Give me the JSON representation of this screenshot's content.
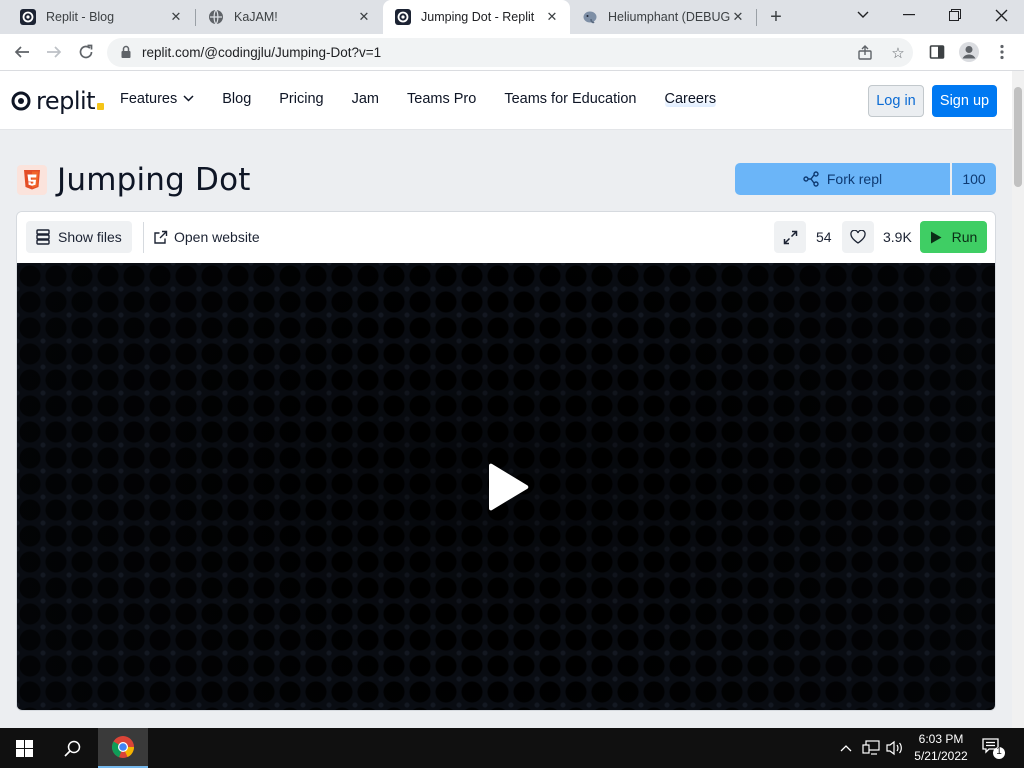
{
  "browser": {
    "tabs": [
      {
        "title": "Replit - Blog",
        "favicon": "replit-favicon-icon",
        "active": false
      },
      {
        "title": "KaJAM!",
        "favicon": "globe-icon",
        "active": false
      },
      {
        "title": "Jumping Dot - Replit",
        "favicon": "replit-favicon-icon",
        "active": true
      },
      {
        "title": "Heliumphant (DEBUG)",
        "favicon": "elephant-icon",
        "active": false
      }
    ],
    "url": "replit.com/@codingjlu/Jumping-Dot?v=1"
  },
  "header": {
    "logo_text": "replit",
    "nav": [
      {
        "label": "Features",
        "dropdown": true
      },
      {
        "label": "Blog"
      },
      {
        "label": "Pricing"
      },
      {
        "label": "Jam"
      },
      {
        "label": "Teams Pro"
      },
      {
        "label": "Teams for Education"
      },
      {
        "label": "Careers"
      }
    ],
    "login_label": "Log in",
    "signup_label": "Sign up"
  },
  "repl": {
    "title": "Jumping Dot",
    "language_icon": "html5-icon",
    "fork_label": "Fork repl",
    "fork_count": "100",
    "show_files_label": "Show files",
    "open_website_label": "Open website",
    "run_count": "54",
    "like_count": "3.9K",
    "run_label": "Run"
  },
  "taskbar": {
    "time": "6:03 PM",
    "date": "5/21/2022",
    "notification_count": "1"
  },
  "colors": {
    "accent": "#0079f2",
    "fork": "#6bb5f8",
    "run": "#3fce64",
    "preview_bg": "#090c12"
  }
}
